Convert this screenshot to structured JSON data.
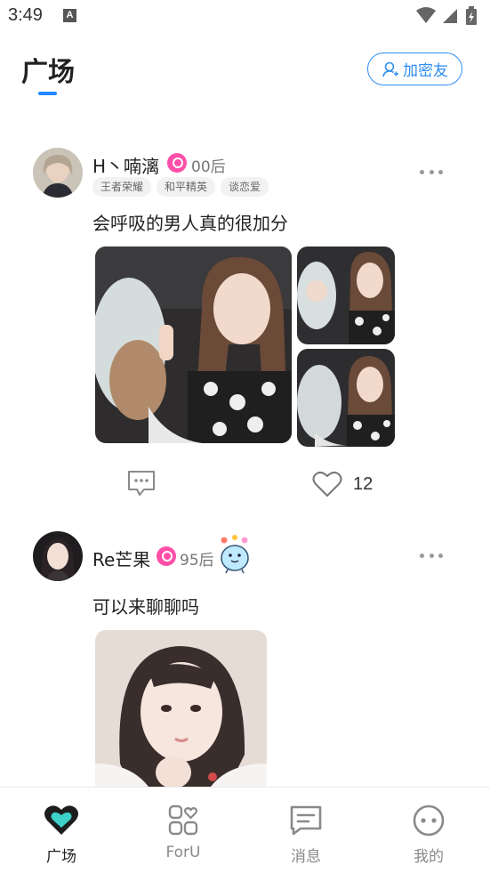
{
  "status_bar": {
    "time": "3:49",
    "notification_icon_letter": "A"
  },
  "header": {
    "title": "广场",
    "add_friend_label": "加密友",
    "accent_color": "#1e88ff"
  },
  "posts": [
    {
      "username": "H丶喃漓",
      "age_group": "00后",
      "tags": [
        "王者荣耀",
        "和平精英",
        "谈恋爱"
      ],
      "text": "会呼吸的男人真的很加分",
      "photo_count": 3,
      "like_count": "12"
    },
    {
      "username": "Re芒果",
      "age_group": "95后",
      "text": "可以来聊聊吗",
      "photo_count": 1
    }
  ],
  "tabs": [
    {
      "label": "广场",
      "icon": "heart-tab-icon",
      "active": true
    },
    {
      "label": "ForU",
      "icon": "grid-heart-icon",
      "active": false
    },
    {
      "label": "消息",
      "icon": "message-icon",
      "active": false
    },
    {
      "label": "我的",
      "icon": "face-icon",
      "active": false
    }
  ],
  "colors": {
    "vip_badge": "#ff4fa8",
    "tab_active_heart": "#3ed1c9",
    "button_blue": "#2f8ef0"
  }
}
